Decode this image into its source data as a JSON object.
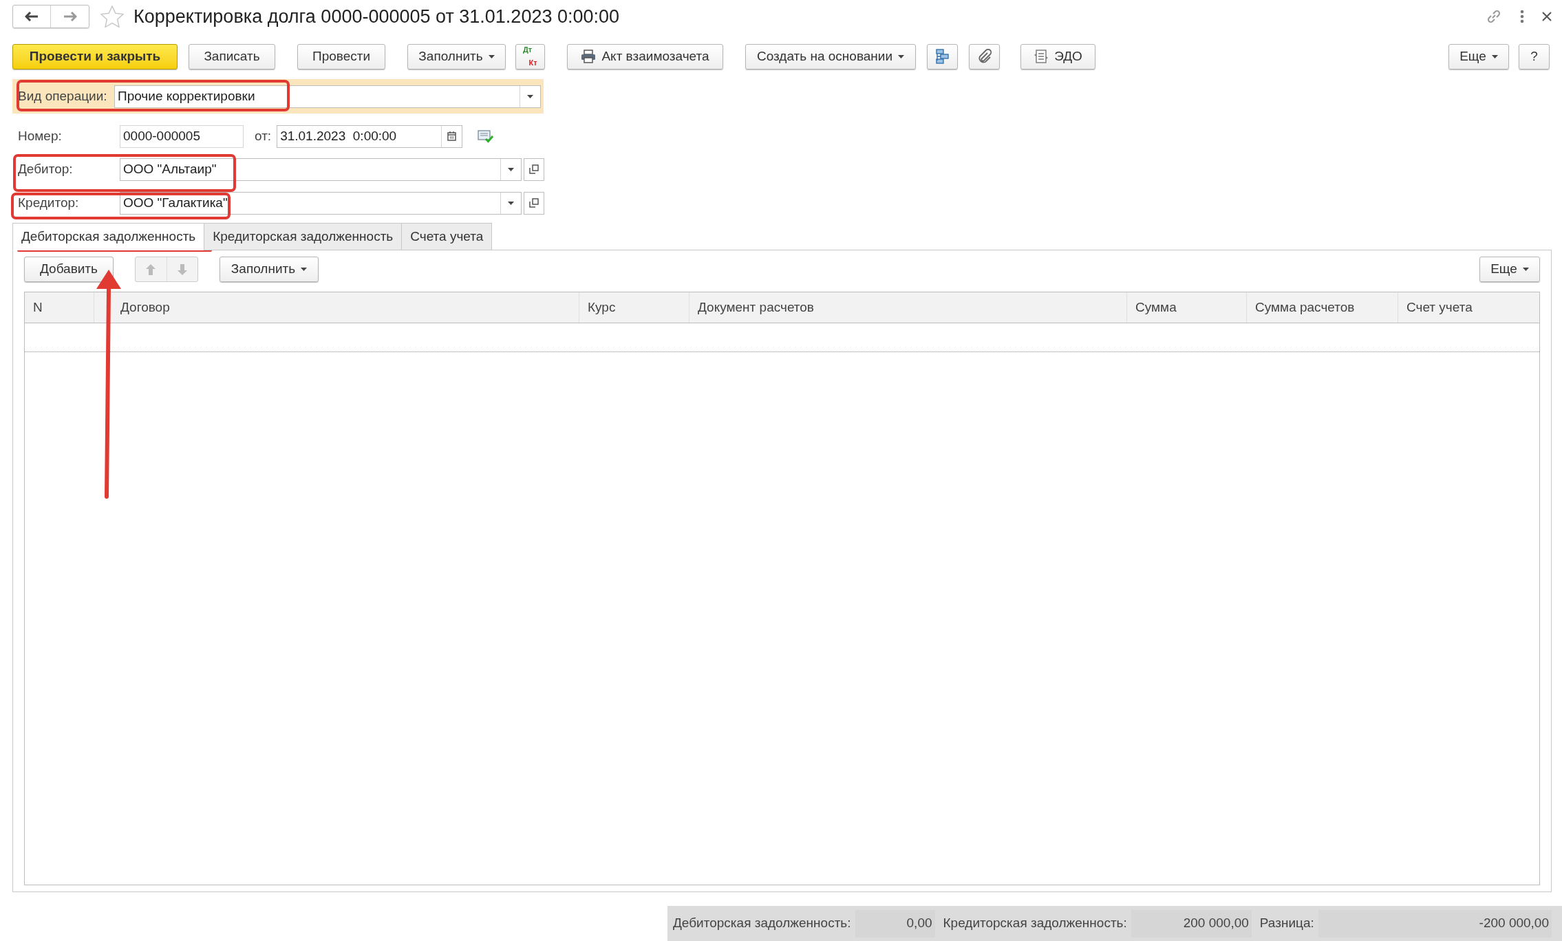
{
  "window": {
    "title": "Корректировка долга 0000-000005 от 31.01.2023 0:00:00"
  },
  "toolbar": [
    {
      "label": "Провести и закрыть",
      "kind": "primary"
    },
    {
      "label": "Записать",
      "kind": "text"
    },
    {
      "label": "Провести",
      "kind": "text"
    },
    {
      "label": "Заполнить",
      "kind": "dropdown"
    },
    {
      "label": "Дт",
      "label_2": "Кт",
      "kind": "dtkt"
    },
    {
      "label": "Акт взаимозачета",
      "kind": "print"
    },
    {
      "label": "Создать на основании",
      "kind": "dropdown"
    },
    {
      "kind": "structure"
    },
    {
      "kind": "attach"
    },
    {
      "label": "ЭДО",
      "kind": "edo"
    }
  ],
  "toolbar_right": [
    {
      "label": "Еще",
      "kind": "dropdown"
    },
    {
      "label": "?",
      "kind": "text"
    }
  ],
  "operation": {
    "label": "Вид операции:",
    "value": "Прочие корректировки"
  },
  "number": {
    "label": "Номер:",
    "value": "0000-000005",
    "date_label": "от:",
    "date": "31.01.2023  0:00:00"
  },
  "debtor": {
    "label": "Дебитор:",
    "value": "ООО \"Альтаир\""
  },
  "creditor": {
    "label": "Кредитор:",
    "value": "ООО \"Галактика\""
  },
  "tabs": [
    {
      "label": "Дебиторская задолженность",
      "selected": true
    },
    {
      "label": "Кредиторская задолженность",
      "selected": false
    },
    {
      "label": "Счета учета",
      "selected": false
    }
  ],
  "table_toolbar": {
    "add": "Добавить",
    "fill": "Заполнить",
    "more": "Еще"
  },
  "table": {
    "columns": [
      "N",
      "Договор",
      "Курс",
      "Документ расчетов",
      "Сумма",
      "Сумма расчетов",
      "Счет учета"
    ]
  },
  "totals": [
    {
      "label": "Дебиторская задолженность:",
      "value": "0,00"
    },
    {
      "label": "Кредиторская задолженность:",
      "value": "200 000,00"
    },
    {
      "label": "Разница:",
      "value": "-200 000,00"
    }
  ]
}
